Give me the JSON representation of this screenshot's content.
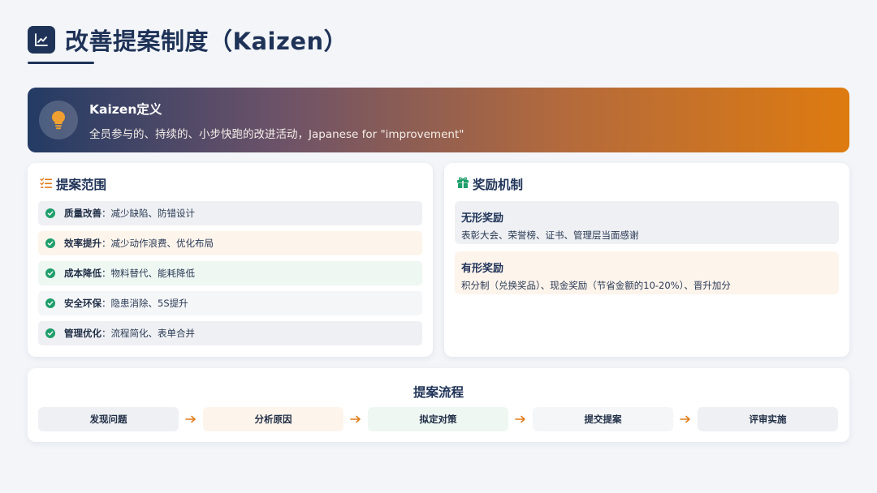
{
  "header": {
    "title": "改善提案制度（Kaizen）",
    "icon": "chart-line-icon"
  },
  "banner": {
    "icon": "lightbulb-icon",
    "title": "Kaizen定义",
    "description": "全员参与的、持续的、小步快跑的改进活动，Japanese for \"improvement\""
  },
  "scope": {
    "icon": "checklist-icon",
    "title": "提案范围",
    "items": [
      {
        "label": "质量改善",
        "desc": "：减少缺陷、防错设计"
      },
      {
        "label": "效率提升",
        "desc": "：减少动作浪费、优化布局"
      },
      {
        "label": "成本降低",
        "desc": "：物料替代、能耗降低"
      },
      {
        "label": "安全环保",
        "desc": "：隐患消除、5S提升"
      },
      {
        "label": "管理优化",
        "desc": "：流程简化、表单合并"
      }
    ]
  },
  "rewards": {
    "icon": "gift-icon",
    "title": "奖励机制",
    "items": [
      {
        "title": "无形奖励",
        "desc": "表彰大会、荣誉榜、证书、管理层当面感谢"
      },
      {
        "title": "有形奖励",
        "desc": "积分制（兑换奖品）、现金奖励（节省金额的10-20%）、晋升加分"
      }
    ]
  },
  "process": {
    "title": "提案流程",
    "steps": [
      "发现问题",
      "分析原因",
      "拟定对策",
      "提交提案",
      "评审实施"
    ]
  },
  "colors": {
    "primary": "#1f3358",
    "accent_orange": "#e07b1a",
    "check_green": "#1e9e6a"
  }
}
